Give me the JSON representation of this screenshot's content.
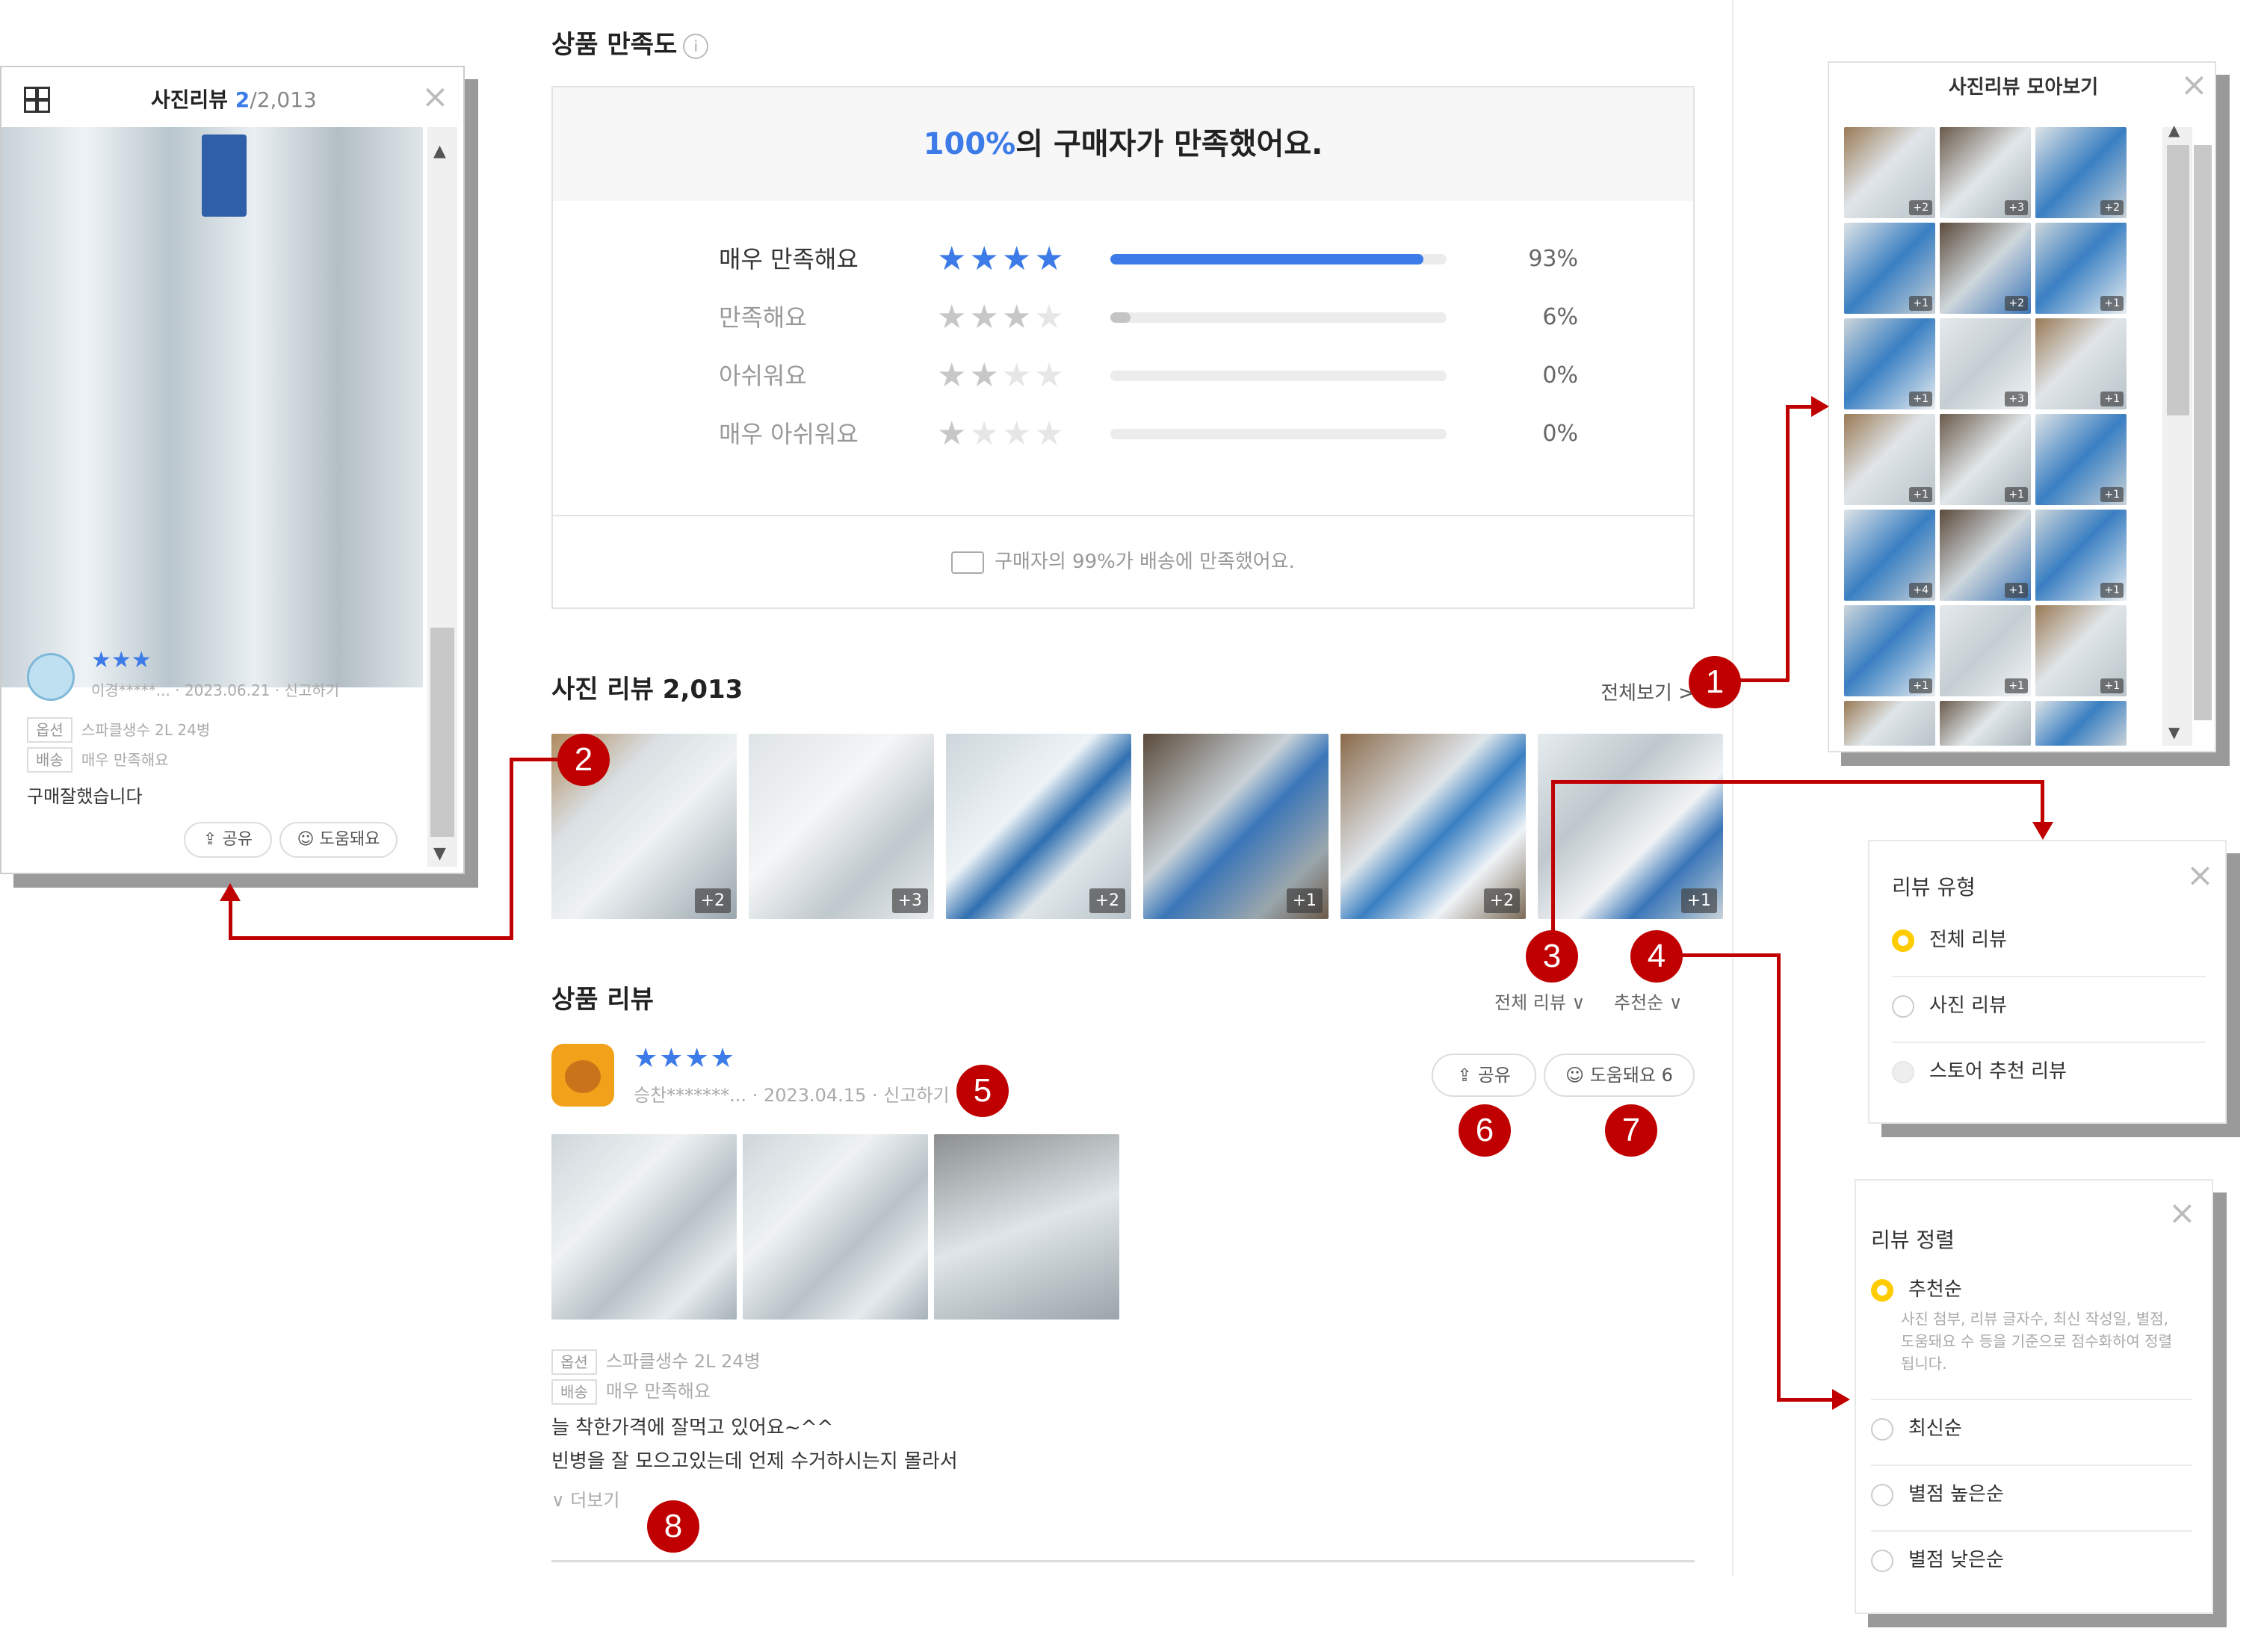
{
  "satisfaction": {
    "title": "상품 만족도",
    "info_icon": "i",
    "headline_pct": "100%",
    "headline_rest": "의 구매자가 만족했어요.",
    "rows": [
      {
        "label": "매우 만족해요",
        "stars": 4,
        "fraction": 0.93,
        "pct": "93%"
      },
      {
        "label": "만족해요",
        "stars": 3,
        "fraction": 0.06,
        "pct": "6%"
      },
      {
        "label": "아쉬워요",
        "stars": 2,
        "fraction": 0.0,
        "pct": "0%"
      },
      {
        "label": "매우 아쉬워요",
        "stars": 1,
        "fraction": 0.0,
        "pct": "0%"
      }
    ],
    "delivery_note": "구매자의 99%가 배송에 만족했어요."
  },
  "photo_reviews": {
    "title": "사진 리뷰 2,013",
    "see_all": "전체보기 >",
    "thumbs": [
      "+2",
      "+3",
      "+2",
      "+1",
      "+2",
      "+1"
    ]
  },
  "product_reviews": {
    "title": "상품 리뷰",
    "filter_type": "전체 리뷰 ∨",
    "filter_sort": "추천순 ∨",
    "review": {
      "stars": "★★★★",
      "author": "승찬*******...",
      "date": "2023.04.15",
      "report": "신고하기",
      "share": "공유",
      "helpful": "도움돼요 6",
      "option_tag": "옵션",
      "option_value": "스파클생수 2L 24병",
      "delivery_tag": "배송",
      "delivery_value": "매우 만족해요",
      "body_line1": "늘 착한가격에 잘먹고 있어요~^^",
      "body_line2": "빈병을 잘 모으고있는데 언제 수거하시는지 몰라서",
      "more": "∨ 더보기"
    }
  },
  "photo_viewer": {
    "title": "사진리뷰",
    "counter_current": "2",
    "counter_total": "/2,013",
    "stars": "★★★",
    "author": "이경*****...",
    "date": "2023.06.21",
    "report": "신고하기",
    "option_tag": "옵션",
    "option_value": "스파클생수 2L 24병",
    "delivery_tag": "배송",
    "delivery_value": "매우 만족해요",
    "body": "구매잘했습니다",
    "share": "공유",
    "helpful": "도움돼요"
  },
  "gallery_popup": {
    "title": "사진리뷰 모아보기",
    "counts": [
      "+2",
      "+3",
      "+2",
      "+1",
      "+2",
      "+1",
      "+1",
      "+3",
      "+1",
      "+1",
      "+1",
      "+1",
      "+4",
      "+1",
      "+1",
      "+1",
      "+1",
      "+1",
      "",
      "",
      ""
    ]
  },
  "review_type_popup": {
    "title": "리뷰 유형",
    "options": [
      "전체 리뷰",
      "사진 리뷰",
      "스토어 추천 리뷰"
    ]
  },
  "review_sort_popup": {
    "title": "리뷰 정렬",
    "options": [
      "추천순",
      "최신순",
      "별점 높은순",
      "별점 낮은순"
    ],
    "recommend_desc": "사진 첨부, 리뷰 글자수, 최신 작성일, 별점, 도움돼요 수 등을 기준으로 점수화하여 정렬됩니다."
  },
  "badges": [
    "1",
    "2",
    "3",
    "4",
    "5",
    "6",
    "7",
    "8"
  ],
  "colors": {
    "accent_blue": "#3d7be8",
    "badge_red": "#c00000",
    "radio_yellow": "#ffcc00"
  }
}
